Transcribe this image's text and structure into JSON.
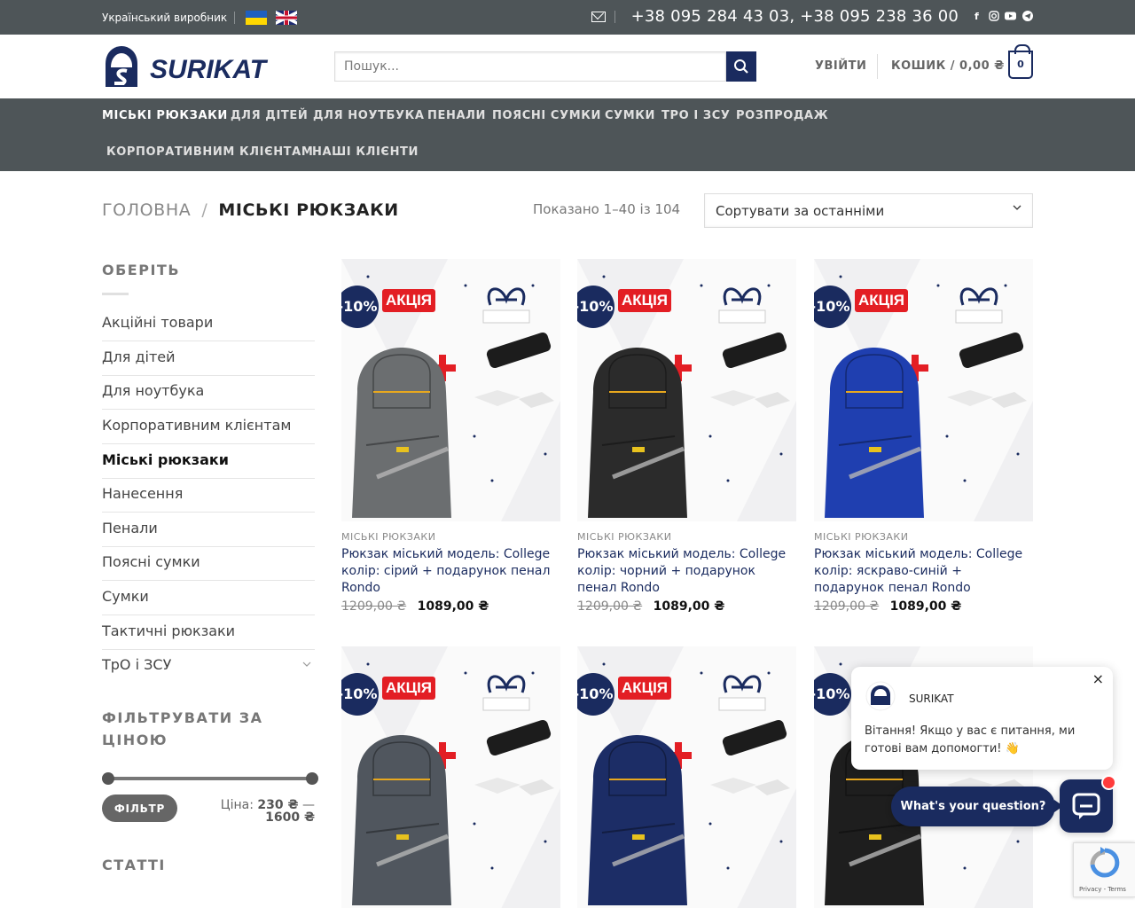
{
  "topbar": {
    "maker": "Український виробник",
    "phones": "+38 095 284 43 03, +38 095 238 36 00",
    "social_icons": [
      "facebook-icon",
      "instagram-icon",
      "youtube-icon",
      "telegram-icon"
    ]
  },
  "header": {
    "logo_text": "SURIKAT",
    "search_placeholder": "Пошук...",
    "login": "УВІЙТИ",
    "cart_label": "КОШИК / 0,00 ₴",
    "cart_count": "0"
  },
  "nav": {
    "items": [
      "МІСЬКІ РЮКЗАКИ",
      "ДЛЯ ДІТЕЙ",
      "ДЛЯ НОУТБУКА",
      "ПЕНАЛИ",
      "ПОЯСНІ СУМКИ",
      "СУМКИ",
      "ТРО І ЗСУ",
      "РОЗПРОДАЖ",
      "КОРПОРАТИВНИМ КЛІЄНТАМ",
      "НАШІ КЛІЄНТИ"
    ]
  },
  "breadcrumb": {
    "home": "ГОЛОВНА",
    "separator": "/",
    "current": "МІСЬКІ РЮКЗАКИ"
  },
  "results_text": "Показано 1–40 із 104",
  "sort_value": "Сортувати за останніми",
  "sidebar": {
    "choose_title": "ОБЕРІТЬ",
    "categories": [
      "Акційні товари",
      "Для дітей",
      "Для ноутбука",
      "Корпоративним клієнтам",
      "Міські рюкзаки",
      "Нанесення",
      "Пенали",
      "Поясні сумки",
      "Сумки",
      "Тактичні рюкзаки",
      "ТрО і ЗСУ"
    ],
    "active_category": "Міські рюкзаки",
    "filter_title_line1": "ФІЛЬТРУВАТИ ЗА",
    "filter_title_line2": "ЦІНОЮ",
    "filter_button": "ФІЛЬТР",
    "price_label": "Ціна:",
    "price_min": "230 ₴",
    "price_dash": "—",
    "price_max": "1600 ₴",
    "articles_title": "СТАТТІ"
  },
  "products": [
    {
      "badge": "-10%",
      "promo": "АКЦІЯ",
      "category": "МІСЬКІ РЮКЗАКИ",
      "title": "Рюкзак міський модель: College колір: сірий + подарунок пенал Rondo",
      "old_price": "1209,00 ₴",
      "price": "1089,00 ₴",
      "color": "#6b6e70"
    },
    {
      "badge": "-10%",
      "promo": "АКЦІЯ",
      "category": "МІСЬКІ РЮКЗАКИ",
      "title": "Рюкзак міський модель: College колір: чорний + подарунок пенал Rondo",
      "old_price": "1209,00 ₴",
      "price": "1089,00 ₴",
      "color": "#2b2b2b"
    },
    {
      "badge": "-10%",
      "promo": "АКЦІЯ",
      "category": "МІСЬКІ РЮКЗАКИ",
      "title": "Рюкзак міський модель: College колір: яскраво-синій + подарунок пенал Rondo",
      "old_price": "1209,00 ₴",
      "price": "1089,00 ₴",
      "color": "#1f3fb0"
    },
    {
      "badge": "-10%",
      "promo": "АКЦІЯ",
      "color": "#50565e"
    },
    {
      "badge": "-10%",
      "promo": "АКЦІЯ",
      "color": "#1c2d66"
    },
    {
      "badge": "-10%",
      "promo": "АКЦІЯ",
      "color": "#1e1e1e"
    }
  ],
  "chat": {
    "name": "SURIKAT",
    "message": "Вітання! Якщо у вас є питання, ми готові вам допомогти! 👋",
    "question": "What's your question?",
    "close": "×"
  },
  "recaptcha": {
    "text": "Privacy - Terms"
  },
  "colors": {
    "brand_navy": "#1a2b5f",
    "topbar_gray": "#4e5558",
    "promo_red": "#e31e24"
  }
}
